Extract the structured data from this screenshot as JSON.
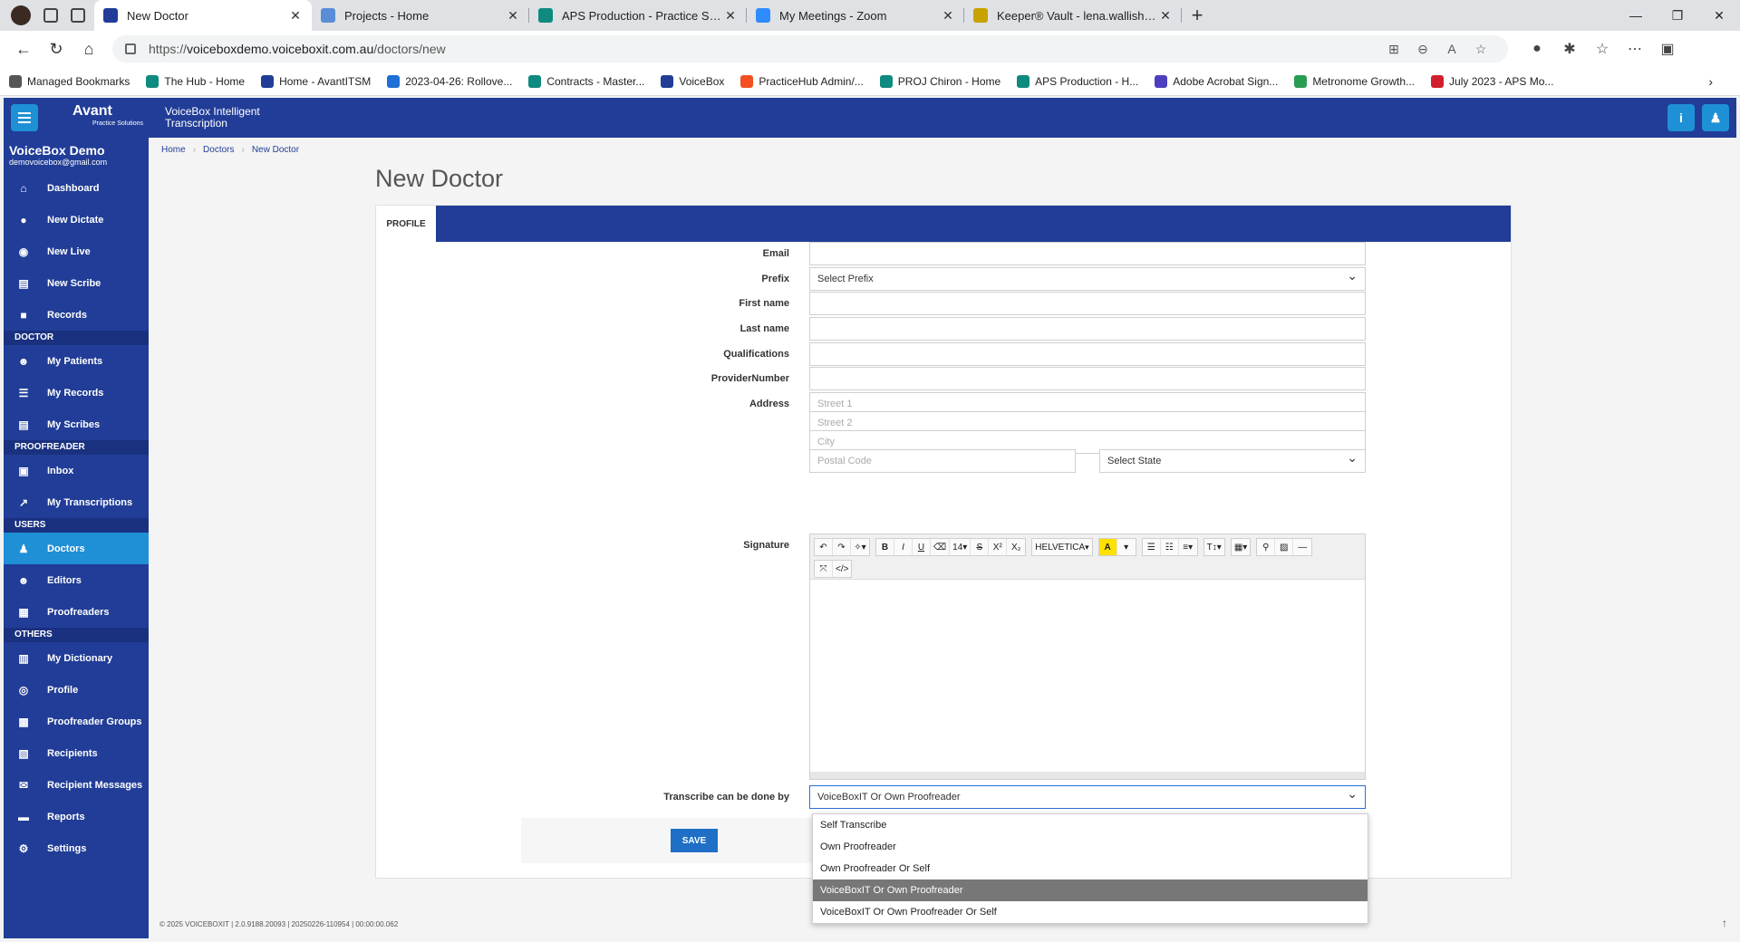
{
  "browser": {
    "tabs": [
      {
        "title": "New Doctor",
        "fav_color": "#213d97",
        "active": true
      },
      {
        "title": "Projects - Home",
        "fav_color": "#5b8dd6",
        "active": false
      },
      {
        "title": "APS Production - Practice Service",
        "fav_color": "#0e8a7e",
        "active": false
      },
      {
        "title": "My Meetings - Zoom",
        "fav_color": "#2d8cff",
        "active": false
      },
      {
        "title": "Keeper® Vault - lena.wallish@ho",
        "fav_color": "#c8a200",
        "active": false
      }
    ],
    "url_prefix": "https://",
    "url_host": "voiceboxdemo.voiceboxit.com.au",
    "url_path": "/doctors/new",
    "bookmarks": [
      {
        "label": "Managed Bookmarks",
        "color": "#555555"
      },
      {
        "label": "The Hub - Home",
        "color": "#0e8a7e"
      },
      {
        "label": "Home - AvantITSM",
        "color": "#213d97"
      },
      {
        "label": "2023-04-26: Rollove...",
        "color": "#1e6fd6"
      },
      {
        "label": "Contracts - Master...",
        "color": "#0e8a7e"
      },
      {
        "label": "VoiceBox",
        "color": "#213d97"
      },
      {
        "label": "PracticeHub Admin/...",
        "color": "#f25022"
      },
      {
        "label": "PROJ Chiron - Home",
        "color": "#0e8a7e"
      },
      {
        "label": "APS Production - H...",
        "color": "#0e8a7e"
      },
      {
        "label": "Adobe Acrobat Sign...",
        "color": "#4b3fbf"
      },
      {
        "label": "Metronome Growth...",
        "color": "#2a9d54"
      },
      {
        "label": "July 2023 - APS Mo...",
        "color": "#d21f2e"
      }
    ]
  },
  "app": {
    "logo": "Avant",
    "logo_sub": "Practice Solutions",
    "title": "VoiceBox Intelligent Transcription",
    "org_name": "VoiceBox Demo",
    "org_email": "demovoicebox@gmail.com"
  },
  "sidebar": {
    "group1": [
      {
        "label": "Dashboard",
        "icon": "home-icon",
        "glyph": "⌂"
      },
      {
        "label": "New Dictate",
        "icon": "microphone-icon",
        "glyph": "●"
      },
      {
        "label": "New Live",
        "icon": "chat-icon",
        "glyph": "◉"
      },
      {
        "label": "New Scribe",
        "icon": "scroll-icon",
        "glyph": "▤"
      },
      {
        "label": "Records",
        "icon": "folder-plus-icon",
        "glyph": "■"
      }
    ],
    "sec_doctor": "DOCTOR",
    "group2": [
      {
        "label": "My Patients",
        "icon": "users-icon",
        "glyph": "☻"
      },
      {
        "label": "My Records",
        "icon": "list-icon",
        "glyph": "☰"
      },
      {
        "label": "My Scribes",
        "icon": "scroll-icon",
        "glyph": "▤"
      }
    ],
    "sec_proofreader": "PROOFREADER",
    "group3": [
      {
        "label": "Inbox",
        "icon": "inbox-icon",
        "glyph": "▣"
      },
      {
        "label": "My Transcriptions",
        "icon": "external-link-icon",
        "glyph": "↗"
      }
    ],
    "sec_users": "USERS",
    "group4": [
      {
        "label": "Doctors",
        "icon": "user-icon",
        "glyph": "♟",
        "active": true
      },
      {
        "label": "Editors",
        "icon": "users-icon",
        "glyph": "☻"
      },
      {
        "label": "Proofreaders",
        "icon": "keyboard-icon",
        "glyph": "▦"
      }
    ],
    "sec_others": "OTHERS",
    "group5": [
      {
        "label": "My Dictionary",
        "icon": "book-icon",
        "glyph": "▥"
      },
      {
        "label": "Profile",
        "icon": "user-circle-icon",
        "glyph": "◎"
      },
      {
        "label": "Proofreader Groups",
        "icon": "group-icon",
        "glyph": "▩"
      },
      {
        "label": "Recipients",
        "icon": "id-card-icon",
        "glyph": "▧"
      },
      {
        "label": "Recipient Messages",
        "icon": "envelope-icon",
        "glyph": "✉"
      },
      {
        "label": "Reports",
        "icon": "folder-icon",
        "glyph": "▬"
      },
      {
        "label": "Settings",
        "icon": "gears-icon",
        "glyph": "⚙"
      }
    ]
  },
  "breadcrumb": {
    "home": "Home",
    "doctors": "Doctors",
    "current": "New Doctor"
  },
  "page": {
    "title": "New Doctor",
    "tab": "PROFILE"
  },
  "form": {
    "email_label": "Email",
    "prefix_label": "Prefix",
    "prefix_value": "Select Prefix",
    "first_name_label": "First name",
    "last_name_label": "Last name",
    "qualifications_label": "Qualifications",
    "provider_label": "ProviderNumber",
    "address_label": "Address",
    "street1_ph": "Street 1",
    "street2_ph": "Street 2",
    "city_ph": "City",
    "postal_ph": "Postal Code",
    "state_value": "Select State",
    "signature_label": "Signature",
    "transcribe_label": "Transcribe can be done by",
    "transcribe_value": "VoiceBoxIT Or Own Proofreader",
    "save": "SAVE"
  },
  "editor_toolbar": {
    "font_size": "14",
    "font_name": "HELVETICA"
  },
  "dropdown_options": [
    "Self Transcribe",
    "Own Proofreader",
    "Own Proofreader Or Self",
    "VoiceBoxIT Or Own Proofreader",
    "VoiceBoxIT Or Own Proofreader Or Self"
  ],
  "dropdown_selected_index": 3,
  "footer": "© 2025 VOICEBOXIT | 2.0.9188.20093 | 20250226-110954 | 00:00:00.062"
}
